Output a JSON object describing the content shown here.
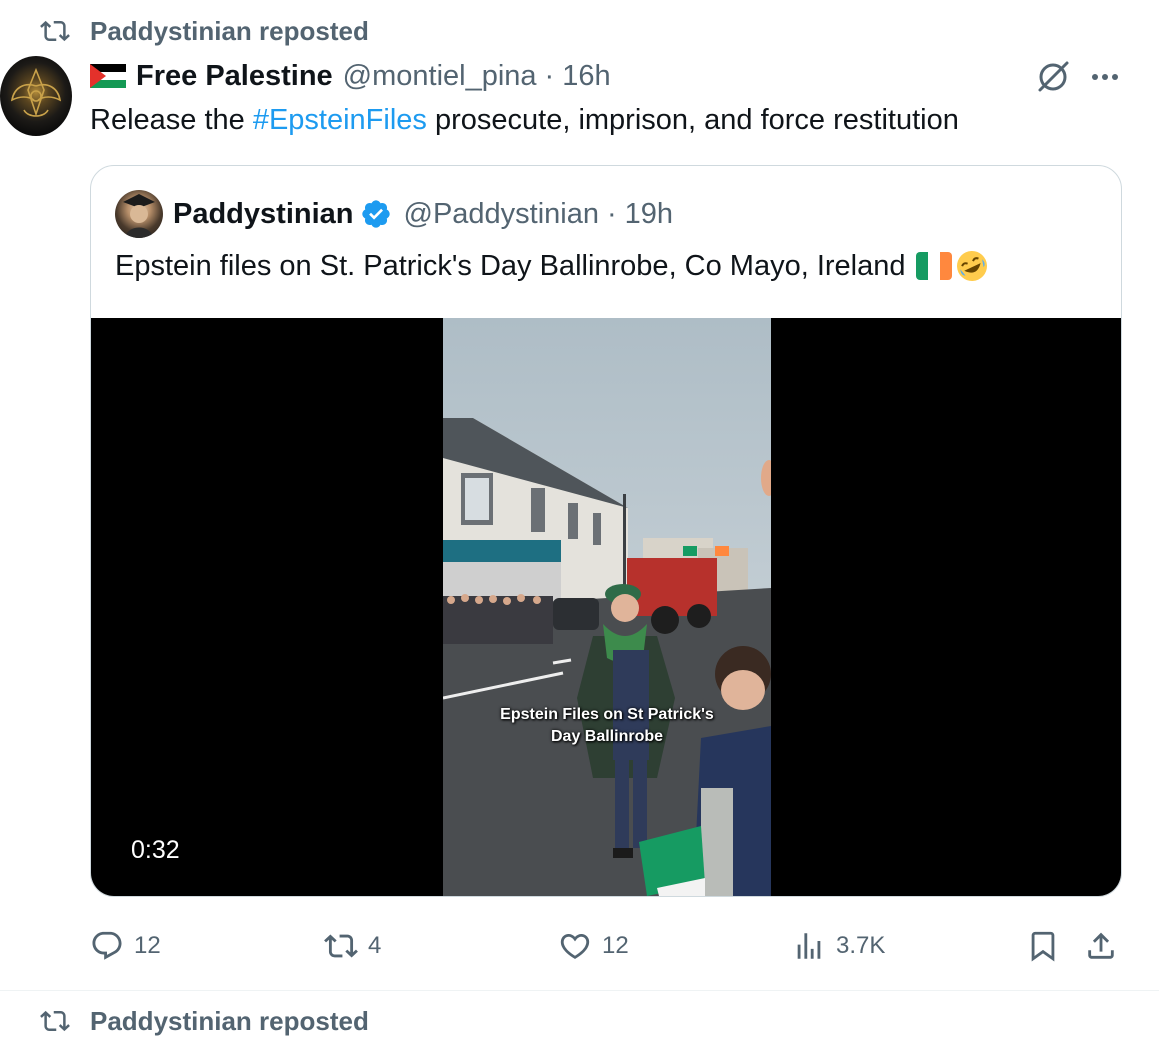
{
  "retweet_header": {
    "label": "Paddystinian reposted"
  },
  "tweet": {
    "display_name": "Free Palestine",
    "handle": "@montiel_pina",
    "separator": "·",
    "time": "16h",
    "text_before": "Release the ",
    "hashtag": "#EpsteinFiles",
    "text_after": " prosecute, imprison, and force restitution"
  },
  "quoted_tweet": {
    "display_name": "Paddystinian",
    "handle": "@Paddystinian",
    "separator": "·",
    "time": "19h",
    "text": "Epstein files on St. Patrick's Day Ballinrobe, Co Mayo, Ireland",
    "video": {
      "caption_line1": "Epstein Files on St Patrick's",
      "caption_line2": "Day Ballinrobe",
      "duration": "0:32"
    }
  },
  "actions": {
    "replies": "12",
    "reposts": "4",
    "likes": "12",
    "views": "3.7K"
  },
  "next_retweet_header": {
    "label": "Paddystinian reposted"
  },
  "colors": {
    "text": "#0f1419",
    "muted": "#536471",
    "link": "#1d9bf0",
    "border": "#cfd9de",
    "verified": "#1d9bf0"
  },
  "icons": [
    "repost-icon",
    "grok-icon",
    "more-icon",
    "verified-icon",
    "reply-icon",
    "like-icon",
    "views-icon",
    "bookmark-icon",
    "share-icon"
  ]
}
